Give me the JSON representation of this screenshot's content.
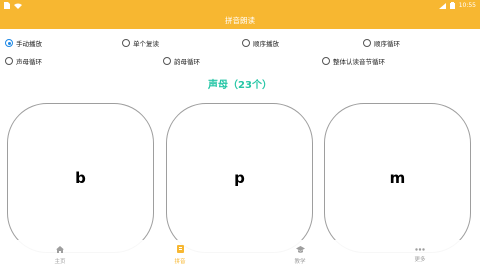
{
  "statusbar": {
    "time": "10:55",
    "icons": [
      "sim-icon",
      "wifi-icon",
      "signal-icon",
      "battery-icon"
    ]
  },
  "appbar": {
    "title": "拼音朗读"
  },
  "options": [
    {
      "label": "手动播放",
      "checked": true
    },
    {
      "label": "单个复读",
      "checked": false
    },
    {
      "label": "顺序播放",
      "checked": false
    },
    {
      "label": "顺序循环",
      "checked": false
    },
    {
      "label": "声母循环",
      "checked": false
    },
    {
      "label": "韵母循环",
      "checked": false
    },
    {
      "label": "整体认读音节循环",
      "checked": false
    }
  ],
  "section": {
    "title": "声母（23个）"
  },
  "cards": [
    "b",
    "p",
    "m"
  ],
  "bottomnav": [
    {
      "label": "主页",
      "icon": "home-icon",
      "active": false
    },
    {
      "label": "拼音",
      "icon": "pinyin-icon",
      "active": true
    },
    {
      "label": "教学",
      "icon": "graduation-cap-icon",
      "active": false
    },
    {
      "label": "更多",
      "icon": "more-dots-icon",
      "active": false
    }
  ],
  "colors": {
    "accent": "#f7b731",
    "title": "#26c6a6",
    "radio": "#1e88e5"
  }
}
